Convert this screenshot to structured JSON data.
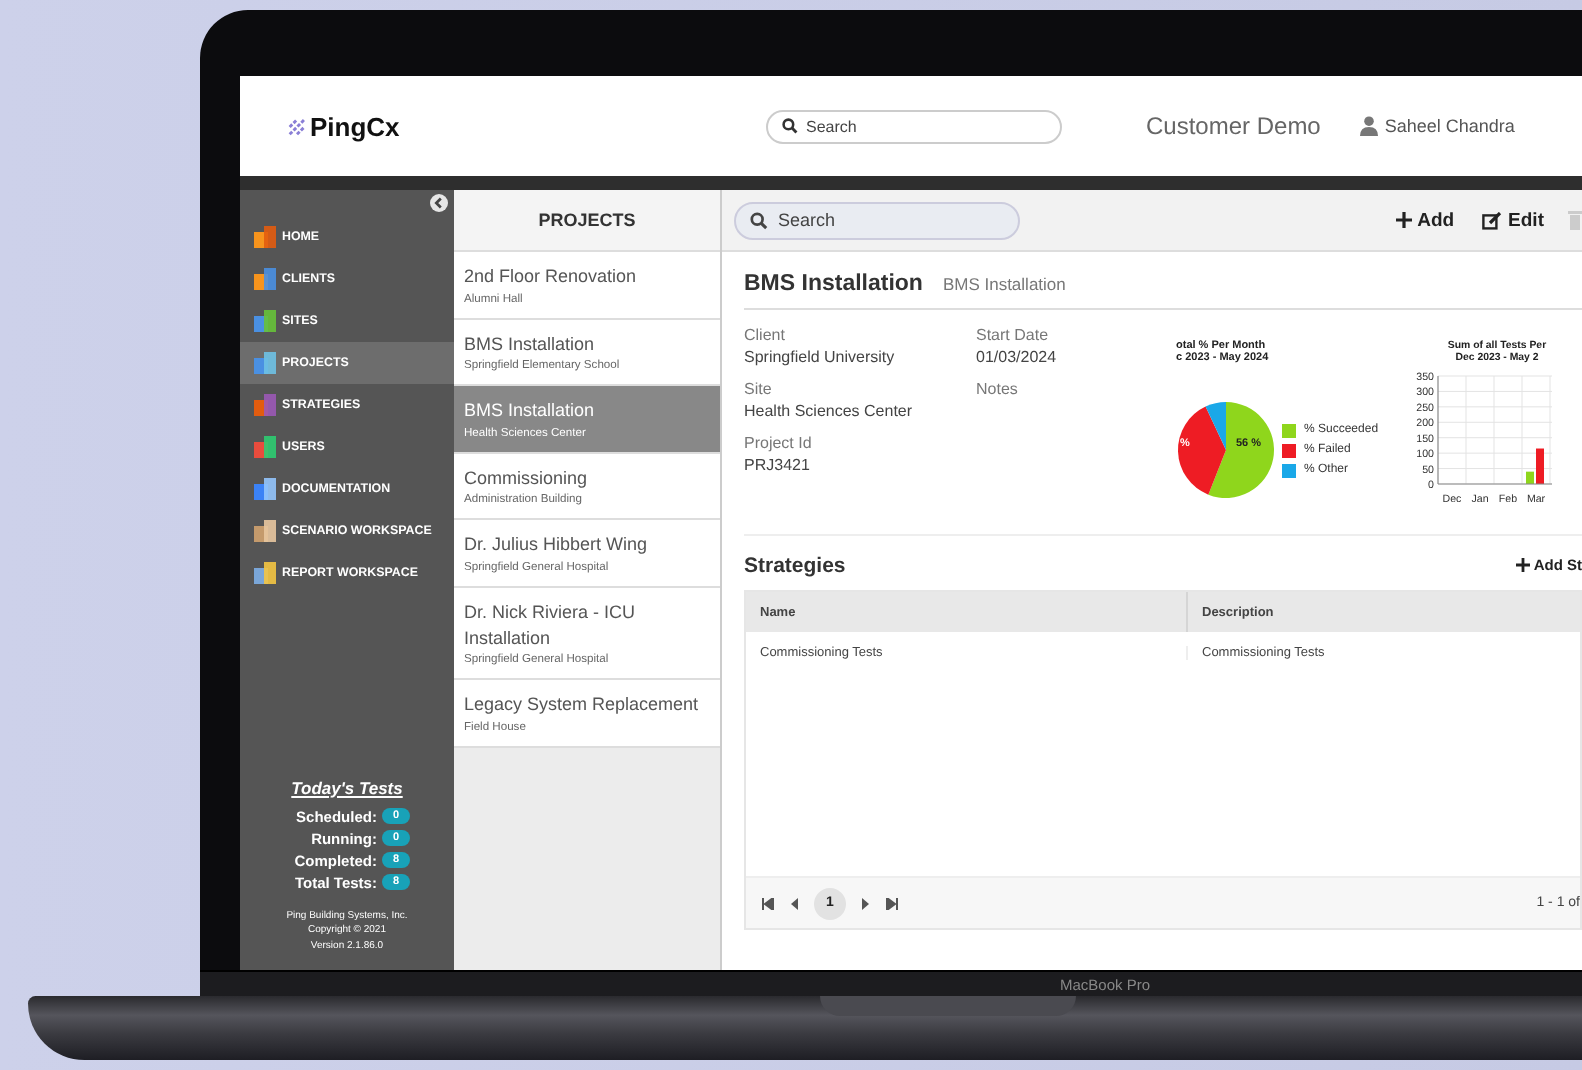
{
  "header": {
    "logo": "PingCx",
    "search": {
      "placeholder": "Search"
    },
    "account": "Customer Demo",
    "user": "Saheel Chandra"
  },
  "sidebar": {
    "items": [
      {
        "label": "HOME",
        "selected": false
      },
      {
        "label": "CLIENTS",
        "selected": false
      },
      {
        "label": "SITES",
        "selected": false
      },
      {
        "label": "PROJECTS",
        "selected": true
      },
      {
        "label": "STRATEGIES",
        "selected": false
      },
      {
        "label": "USERS",
        "selected": false
      },
      {
        "label": "DOCUMENTATION",
        "selected": false
      },
      {
        "label": "SCENARIO WORKSPACE",
        "selected": false
      },
      {
        "label": "REPORT WORKSPACE",
        "selected": false
      }
    ],
    "todays_tests": {
      "title": "Today's Tests",
      "counts": [
        {
          "label": "Scheduled:",
          "value": "0"
        },
        {
          "label": "Running:",
          "value": "0"
        },
        {
          "label": "Completed:",
          "value": "8"
        },
        {
          "label": "Total Tests:",
          "value": "8"
        }
      ]
    },
    "footer": [
      "Ping Building Systems, Inc.",
      "Copyright © 2021",
      "Version 2.1.86.0"
    ]
  },
  "projects": {
    "title": "PROJECTS",
    "items": [
      {
        "name": "2nd Floor Renovation",
        "site": "Alumni Hall",
        "selected": false
      },
      {
        "name": "BMS Installation",
        "site": "Springfield Elementary School",
        "selected": false
      },
      {
        "name": "BMS Installation",
        "site": "Health Sciences Center",
        "selected": true
      },
      {
        "name": "Commissioning",
        "site": "Administration Building",
        "selected": false
      },
      {
        "name": "Dr. Julius Hibbert Wing",
        "site": "Springfield General Hospital",
        "selected": false
      },
      {
        "name": "Dr. Nick Riviera - ICU Installation",
        "site": "Springfield General Hospital",
        "selected": false
      },
      {
        "name": "Legacy System Replacement",
        "site": "Field House",
        "selected": false
      }
    ]
  },
  "toolbar": {
    "search": {
      "placeholder": "Search"
    },
    "add": "Add",
    "edit": "Edit"
  },
  "detail": {
    "title": "BMS Installation",
    "subtitle": "BMS Installation",
    "fields": [
      {
        "label": "Client",
        "value": "Springfield University"
      },
      {
        "label": "Start Date",
        "value": "01/03/2024"
      },
      {
        "label": "Site",
        "value": "Health Sciences Center"
      },
      {
        "label": "Notes"
      },
      {
        "label": "Project Id",
        "value": "PRJ3421"
      }
    ],
    "pie": {
      "title": [
        "otal % Per Month",
        "c 2023 -  May 2024"
      ],
      "slice_labels": [
        "%",
        "56 %"
      ],
      "legend": [
        {
          "label": "% Succeeded",
          "color": "#8fd61c"
        },
        {
          "label": "% Failed",
          "color": "#ee1c24"
        },
        {
          "label": "% Other",
          "color": "#1aa8e8"
        }
      ]
    },
    "bar": {
      "title": [
        "Sum of all Tests Per",
        "Dec 2023 -  May 2"
      ],
      "chart_data": {
        "type": "bar",
        "categories": [
          "Dec",
          "Jan",
          "Feb",
          "Mar"
        ],
        "series": [
          {
            "color": "#8fd61c",
            "values": [
              0,
              0,
              0,
              40
            ]
          },
          {
            "color": "#ee1c24",
            "values": [
              0,
              0,
              0,
              115
            ]
          }
        ],
        "grid": true,
        "ylim": [
          0,
          350
        ],
        "yticks": [
          0,
          50,
          100,
          150,
          200,
          250,
          300,
          350
        ]
      }
    }
  },
  "strategies": {
    "title": "Strategies",
    "add": "Add St",
    "columns": [
      "Name",
      "Description"
    ],
    "rows": [
      [
        "Commissioning Tests",
        "Commissioning Tests"
      ]
    ],
    "pager": {
      "pages": [
        {
          "label": "1",
          "selected": true
        }
      ],
      "summary": "1 - 1 of"
    }
  },
  "device_label": "MacBook Pro"
}
